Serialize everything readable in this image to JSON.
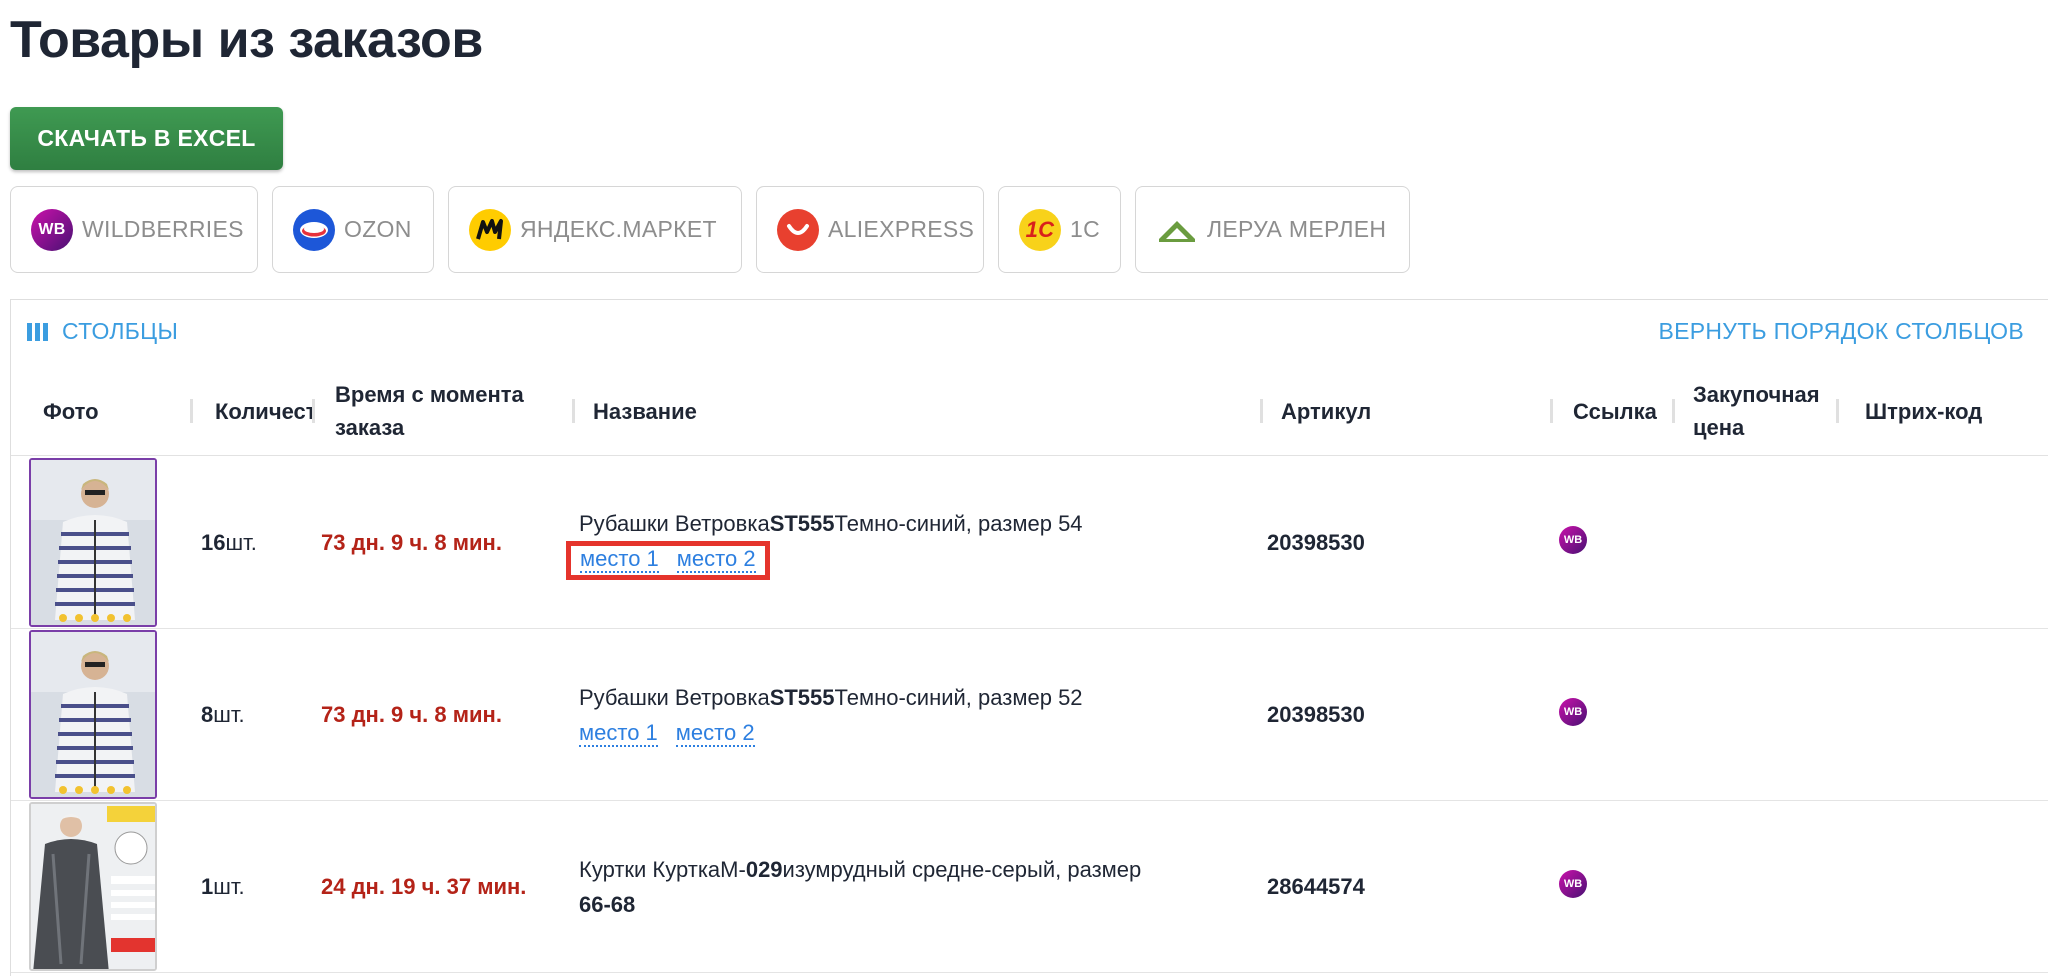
{
  "page": {
    "title": "Товары из заказов"
  },
  "toolbar": {
    "excel_label": "СКАЧАТЬ В EXCEL"
  },
  "marketplaces": [
    {
      "label": "WILDBERRIES",
      "icon": "wildberries-logo-icon"
    },
    {
      "label": "OZON",
      "icon": "ozon-logo-icon"
    },
    {
      "label": "ЯНДЕКС.МАРКЕТ",
      "icon": "yandex-market-logo-icon"
    },
    {
      "label": "ALIEXPRESS",
      "icon": "aliexpress-logo-icon"
    },
    {
      "label": "1C",
      "icon": "1c-logo-icon"
    },
    {
      "label": "ЛЕРУА МЕРЛЕН",
      "icon": "leroy-merlin-logo-icon"
    }
  ],
  "table": {
    "columns_label": "СТОЛБЦЫ",
    "reset_label": "ВЕРНУТЬ ПОРЯДОК СТОЛБЦОВ",
    "headers": {
      "photo": "Фото",
      "qty": "Количество",
      "time_line1": "Время с момента",
      "time_line2": "заказа",
      "name": "Название",
      "sku": "Артикул",
      "link": "Ссылка",
      "price_line1": "Закупочная",
      "price_line2": "цена",
      "barcode": "Штрих-код"
    },
    "unit": "шт.",
    "rows": [
      {
        "qty": "16",
        "time": "73 дн. 9 ч. 8 мин.",
        "name_plain1": "Рубашки Ветровка",
        "name_bold": "ST555",
        "name_plain2": "Темно-синий, размер ",
        "name_size": "54",
        "link1": "место 1",
        "link2": "место 2",
        "sku": "20398530",
        "link_badge": "WB"
      },
      {
        "qty": "8",
        "time": "73 дн. 9 ч. 8 мин.",
        "name_plain1": "Рубашки Ветровка",
        "name_bold": "ST555",
        "name_plain2": "Темно-синий, размер ",
        "name_size": "52",
        "link1": "место 1",
        "link2": "место 2",
        "sku": "20398530",
        "link_badge": "WB"
      },
      {
        "qty": "1",
        "time": "24 дн. 19 ч. 37 мин.",
        "name_plain1": "Куртки КурткаМ-",
        "name_bold": "029",
        "name_plain2": "изумрудный средне-серый, размер",
        "name_size": "66-68",
        "sku": "28644574",
        "link_badge": "WB"
      }
    ]
  },
  "colors": {
    "excel_green": "#3a8f4c",
    "link_blue": "#3b9de0",
    "time_red": "#b42318",
    "highlight_red": "#e5342c",
    "wb_purple": "#7a3ea8"
  }
}
